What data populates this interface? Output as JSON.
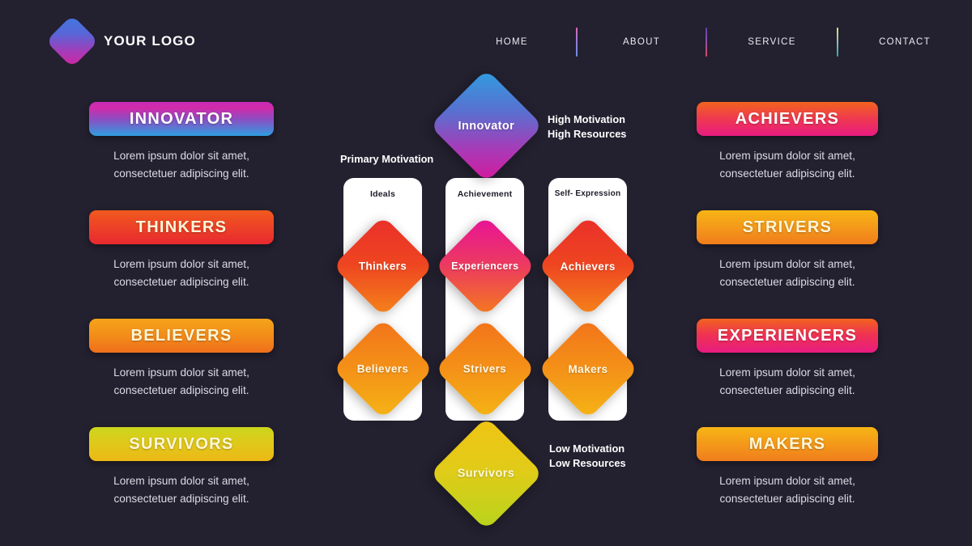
{
  "brand": {
    "name": "YOUR LOGO",
    "logo_icon": "diamond-logo-icon"
  },
  "nav": {
    "items": [
      {
        "label": "HOME"
      },
      {
        "label": "ABOUT"
      },
      {
        "label": "SERVICE"
      },
      {
        "label": "CONTACT"
      }
    ],
    "separator_colors": [
      "#8f7fd8",
      "#8c4fb0",
      "#8fc4a8"
    ]
  },
  "description_text": "Lorem ipsum dolor sit amet, consectetuer adipiscing elit.",
  "left_column": [
    {
      "label": "INNOVATOR",
      "desc": "Lorem ipsum dolor sit amet, consectetuer adipiscing elit.",
      "color": "#c92bb7"
    },
    {
      "label": "THINKERS",
      "desc": "Lorem ipsum dolor sit amet, consectetuer adipiscing elit.",
      "color": "#ed4426"
    },
    {
      "label": "BELIEVERS",
      "desc": "Lorem ipsum dolor sit amet, consectetuer adipiscing elit.",
      "color": "#f38f19"
    },
    {
      "label": "SURVIVORS",
      "desc": "Lorem ipsum dolor sit amet, consectetuer adipiscing elit.",
      "color": "#e0c81b"
    }
  ],
  "right_column": [
    {
      "label": "ACHIEVERS",
      "desc": "Lorem ipsum dolor sit amet, consectetuer adipiscing elit.",
      "color": "#ef3a4e"
    },
    {
      "label": "STRIVERS",
      "desc": "Lorem ipsum dolor sit amet, consectetuer adipiscing elit.",
      "color": "#f4991a"
    },
    {
      "label": "EXPERIENCERS",
      "desc": "Lorem ipsum dolor sit amet, consectetuer adipiscing elit.",
      "color": "#e81b82"
    },
    {
      "label": "MAKERS",
      "desc": "Lorem ipsum dolor sit amet, consectetuer adipiscing elit.",
      "color": "#f4991a"
    }
  ],
  "diagram": {
    "top_node": {
      "label": "Innovator",
      "color": "#a63cb8"
    },
    "bottom_node": {
      "label": "Survivors",
      "color": "#d4c818"
    },
    "annotations": {
      "primary_motivation": "Primary Motivation",
      "high": "High Motivation\nHigh Resources",
      "high_line1": "High Motivation",
      "high_line2": "High Resources",
      "low": "Low Motivation\nLow Resources",
      "low_line1": "Low Motivation",
      "low_line2": "Low Resources"
    },
    "columns": [
      {
        "header": "Ideals",
        "nodes": [
          {
            "label": "Thinkers",
            "color": "#ee4521"
          },
          {
            "label": "Believers",
            "color": "#f49118"
          }
        ]
      },
      {
        "header": "Achievement",
        "nodes": [
          {
            "label": "Experiencers",
            "color": "#ec3b5e"
          },
          {
            "label": "Strivers",
            "color": "#f49118"
          }
        ]
      },
      {
        "header": "Self- Expression",
        "nodes": [
          {
            "label": "Achievers",
            "color": "#ee4521"
          },
          {
            "label": "Makers",
            "color": "#f49118"
          }
        ]
      }
    ]
  },
  "theme": {
    "background": "#23202f",
    "card_background": "#ffffff",
    "text_primary": "#ffffff",
    "text_secondary": "#dedbe6"
  }
}
